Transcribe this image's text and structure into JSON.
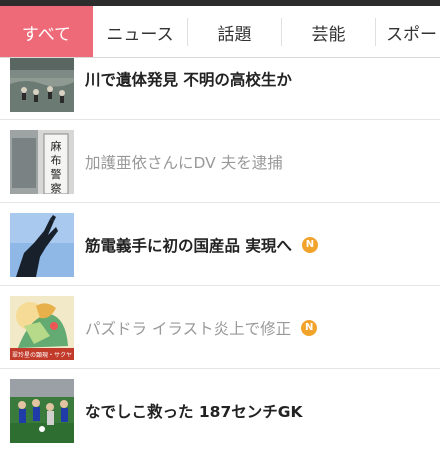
{
  "tabs": [
    {
      "label": "すべて",
      "active": true
    },
    {
      "label": "ニュース",
      "active": false
    },
    {
      "label": "話題",
      "active": false
    },
    {
      "label": "芸能",
      "active": false
    },
    {
      "label": "スポー",
      "active": false
    }
  ],
  "articles": [
    {
      "title": "川で遺体発見 不明の高校生か",
      "read": false,
      "badge": ""
    },
    {
      "title": "加護亜依さんにDV 夫を逮捕",
      "read": true,
      "badge": "",
      "thumb_text": "麻布警察"
    },
    {
      "title": "筋電義手に初の国産品 実現へ",
      "read": false,
      "badge": "N"
    },
    {
      "title": "パズドラ イラスト炎上で修正",
      "read": true,
      "badge": "N",
      "thumb_text": "翠玲星の顕現・サクヤ"
    },
    {
      "title": "なでしこ救った 187センチGK",
      "read": false,
      "badge": ""
    }
  ],
  "colors": {
    "active_tab": "#ef6a78",
    "badge": "#f2a32c",
    "read_text": "#999999"
  }
}
